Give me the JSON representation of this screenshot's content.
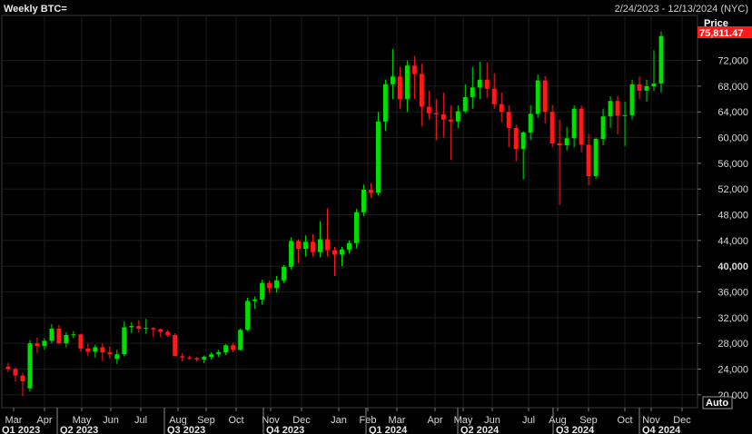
{
  "header": {
    "title": "Weekly BTC=",
    "date_range": "2/24/2023 - 12/13/2024 (NYC)"
  },
  "controls": {
    "auto_label": "Auto"
  },
  "colors": {
    "up": "#00e000",
    "down": "#ff1a1a",
    "grid": "#1c1c1c",
    "background": "#000000",
    "last_price_bg": "#ff1a1a"
  },
  "chart_data": {
    "type": "candlestick",
    "title": "Weekly BTC=",
    "ylabel": "Price",
    "ylim": [
      18000,
      79000
    ],
    "last_price": "75,811.47",
    "y_ticks": [
      "20,000",
      "24,000",
      "28,000",
      "32,000",
      "36,000",
      "40,000",
      "44,000",
      "48,000",
      "52,000",
      "56,000",
      "60,000",
      "64,000",
      "68,000",
      "72,000"
    ],
    "y_tick_values": [
      20000,
      24000,
      28000,
      32000,
      36000,
      40000,
      44000,
      48000,
      52000,
      56000,
      60000,
      64000,
      68000,
      72000
    ],
    "x_months": [
      "Mar",
      "Apr",
      "May",
      "Jun",
      "Jul",
      "Aug",
      "Sep",
      "Oct",
      "Nov",
      "Dec",
      "Jan",
      "Feb",
      "Mar",
      "Apr",
      "May",
      "Jun",
      "Jul",
      "Aug",
      "Sep",
      "Oct",
      "Nov",
      "Dec"
    ],
    "x_quarters": [
      "Q1 2023",
      "Q2 2023",
      "Q3 2023",
      "Q4 2023",
      "Q1 2024",
      "Q2 2024",
      "Q3 2024",
      "Q4 2024"
    ],
    "candles": [
      [
        24400,
        25000,
        23500,
        24000
      ],
      [
        24000,
        24300,
        22000,
        23000
      ],
      [
        23000,
        23400,
        19800,
        22100
      ],
      [
        21000,
        28500,
        20500,
        28000
      ],
      [
        28000,
        28900,
        26500,
        27600
      ],
      [
        27600,
        28800,
        27000,
        28400
      ],
      [
        28400,
        31000,
        28000,
        30300
      ],
      [
        30300,
        30900,
        27900,
        28000
      ],
      [
        28000,
        29700,
        27400,
        29300
      ],
      [
        29300,
        29900,
        28800,
        29400
      ],
      [
        29400,
        29500,
        26700,
        27200
      ],
      [
        27200,
        28000,
        26000,
        26700
      ],
      [
        26700,
        27800,
        25800,
        27400
      ],
      [
        27400,
        28000,
        25300,
        26600
      ],
      [
        26600,
        27500,
        25700,
        26300
      ],
      [
        25600,
        27000,
        24800,
        26300
      ],
      [
        26300,
        31400,
        26000,
        30500
      ],
      [
        30500,
        31300,
        29600,
        30700
      ],
      [
        30700,
        31600,
        29700,
        30300
      ],
      [
        30300,
        31800,
        29500,
        30400
      ],
      [
        30400,
        30500,
        29000,
        30200
      ],
      [
        30200,
        30300,
        29000,
        29800
      ],
      [
        29800,
        30100,
        29000,
        29300
      ],
      [
        29300,
        29600,
        26000,
        26000
      ],
      [
        26000,
        26500,
        25200,
        25800
      ],
      [
        25800,
        26100,
        25500,
        25700
      ],
      [
        25700,
        25900,
        25200,
        25500
      ],
      [
        25500,
        26100,
        24900,
        25900
      ],
      [
        25900,
        26600,
        25500,
        26300
      ],
      [
        26300,
        27000,
        25900,
        26600
      ],
      [
        26600,
        27900,
        26200,
        27700
      ],
      [
        27700,
        28100,
        26600,
        27000
      ],
      [
        27000,
        30300,
        26900,
        30100
      ],
      [
        30100,
        35100,
        29900,
        34600
      ],
      [
        34600,
        35300,
        33400,
        34800
      ],
      [
        34800,
        37900,
        34000,
        37400
      ],
      [
        37400,
        37800,
        35800,
        36600
      ],
      [
        36600,
        38500,
        35900,
        37800
      ],
      [
        37800,
        40200,
        37400,
        39900
      ],
      [
        39900,
        44500,
        39500,
        43900
      ],
      [
        43900,
        44200,
        40500,
        42700
      ],
      [
        42700,
        44800,
        41500,
        43800
      ],
      [
        43800,
        45000,
        41500,
        42200
      ],
      [
        42200,
        47000,
        41400,
        44200
      ],
      [
        44200,
        49000,
        41500,
        42500
      ],
      [
        42500,
        43000,
        38500,
        41800
      ],
      [
        41800,
        43000,
        40000,
        42600
      ],
      [
        42600,
        44000,
        42000,
        43600
      ],
      [
        43600,
        48900,
        42800,
        48400
      ],
      [
        48400,
        52700,
        47800,
        51900
      ],
      [
        51900,
        52900,
        50600,
        51400
      ],
      [
        51400,
        64000,
        51000,
        62500
      ],
      [
        62500,
        69000,
        61000,
        68300
      ],
      [
        68300,
        73800,
        66000,
        69500
      ],
      [
        69500,
        71000,
        64500,
        66000
      ],
      [
        66000,
        72000,
        64000,
        71200
      ],
      [
        71200,
        72700,
        66000,
        69900
      ],
      [
        69900,
        71500,
        61800,
        64800
      ],
      [
        64800,
        67300,
        62800,
        63800
      ],
      [
        63800,
        66000,
        59600,
        63600
      ],
      [
        63600,
        67000,
        60000,
        62800
      ],
      [
        62800,
        65000,
        56500,
        62500
      ],
      [
        62500,
        65000,
        61500,
        64100
      ],
      [
        64100,
        68300,
        63800,
        66300
      ],
      [
        66300,
        71000,
        64500,
        67800
      ],
      [
        67800,
        71800,
        66000,
        69000
      ],
      [
        69000,
        71700,
        66200,
        67600
      ],
      [
        67600,
        70000,
        64500,
        65200
      ],
      [
        65200,
        67000,
        62400,
        64000
      ],
      [
        64000,
        65000,
        58500,
        61500
      ],
      [
        61500,
        62000,
        56300,
        58200
      ],
      [
        58200,
        61000,
        53500,
        60800
      ],
      [
        60800,
        65000,
        59600,
        63700
      ],
      [
        63700,
        69800,
        63100,
        68900
      ],
      [
        68900,
        69600,
        62200,
        64000
      ],
      [
        64000,
        65100,
        58500,
        59100
      ],
      [
        59100,
        62800,
        49500,
        58800
      ],
      [
        58800,
        61600,
        58000,
        59900
      ],
      [
        59900,
        65000,
        58500,
        64500
      ],
      [
        64500,
        65000,
        57700,
        58900
      ],
      [
        58900,
        60600,
        52600,
        54000
      ],
      [
        54000,
        60000,
        53600,
        59800
      ],
      [
        59800,
        64500,
        58800,
        63300
      ],
      [
        63300,
        66400,
        61500,
        65700
      ],
      [
        65700,
        66500,
        60500,
        63400
      ],
      [
        63400,
        65600,
        58700,
        63500
      ],
      [
        63500,
        69000,
        62800,
        68300
      ],
      [
        68300,
        69500,
        66000,
        67300
      ],
      [
        67300,
        69000,
        65600,
        68000
      ],
      [
        68000,
        73600,
        67300,
        68400
      ],
      [
        68400,
        76500,
        67000,
        75800
      ]
    ]
  }
}
